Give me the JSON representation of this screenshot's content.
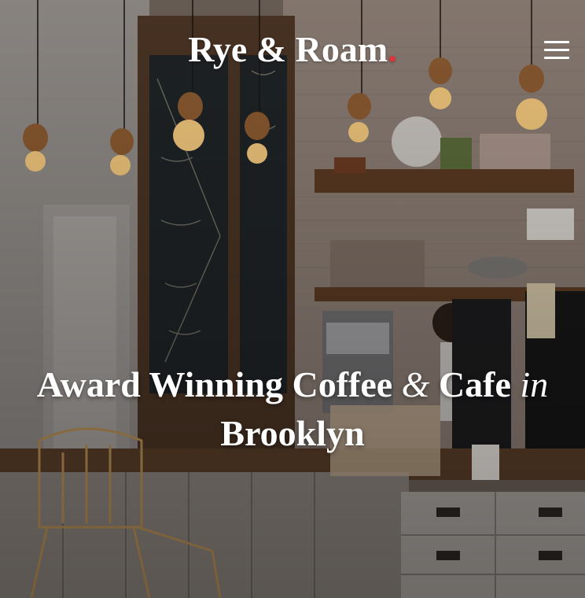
{
  "brand": {
    "name": "Rye & Roam",
    "dot": "."
  },
  "menu": {
    "icon": "hamburger-menu-icon"
  },
  "hero": {
    "headline_a": "Award Winning Coffee ",
    "headline_amp": "&",
    "headline_b": " Cafe ",
    "headline_in": "in",
    "headline_c": "Brooklyn",
    "image": "coffee-shop-interior"
  },
  "colors": {
    "accent": "#e0333a",
    "text": "#ffffff"
  }
}
